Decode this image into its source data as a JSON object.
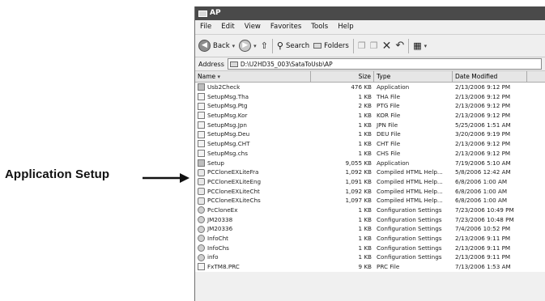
{
  "callout": {
    "label": "Application Setup"
  },
  "window": {
    "title": "AP",
    "menu": [
      "File",
      "Edit",
      "View",
      "Favorites",
      "Tools",
      "Help"
    ],
    "toolbar": {
      "back": "Back",
      "search": "Search",
      "folders": "Folders"
    },
    "address": {
      "label": "Address",
      "path": "D:\\U2HD35_003\\SataToUsb\\AP"
    },
    "columns": {
      "name": "Name",
      "size": "Size",
      "type": "Type",
      "date": "Date Modified"
    },
    "files": [
      {
        "name": "Usb2Check",
        "size": "476 KB",
        "type": "Application",
        "date": "2/13/2006 9:12 PM",
        "icon": "app"
      },
      {
        "name": "SetupMsg.Tha",
        "size": "1 KB",
        "type": "THA File",
        "date": "2/13/2006 9:12 PM",
        "icon": "file"
      },
      {
        "name": "SetupMsg.Ptg",
        "size": "2 KB",
        "type": "PTG File",
        "date": "2/13/2006 9:12 PM",
        "icon": "file"
      },
      {
        "name": "SetupMsg.Kor",
        "size": "1 KB",
        "type": "KOR File",
        "date": "2/13/2006 9:12 PM",
        "icon": "file"
      },
      {
        "name": "SetupMsg.Jpn",
        "size": "1 KB",
        "type": "JPN File",
        "date": "5/25/2006 1:51 AM",
        "icon": "file"
      },
      {
        "name": "SetupMsg.Deu",
        "size": "1 KB",
        "type": "DEU File",
        "date": "3/20/2006 9:19 PM",
        "icon": "file"
      },
      {
        "name": "SetupMsg.CHT",
        "size": "1 KB",
        "type": "CHT File",
        "date": "2/13/2006 9:12 PM",
        "icon": "file"
      },
      {
        "name": "SetupMsg.chs",
        "size": "1 KB",
        "type": "CHS File",
        "date": "2/13/2006 9:12 PM",
        "icon": "file"
      },
      {
        "name": "Setup",
        "size": "9,055 KB",
        "type": "Application",
        "date": "7/19/2006 5:10 AM",
        "icon": "app"
      },
      {
        "name": "PCCloneEXLiteFra",
        "size": "1,092 KB",
        "type": "Compiled HTML Help...",
        "date": "5/8/2006 12:42 AM",
        "icon": "help"
      },
      {
        "name": "PCCloneEXLiteEng",
        "size": "1,091 KB",
        "type": "Compiled HTML Help...",
        "date": "6/8/2006 1:00 AM",
        "icon": "help"
      },
      {
        "name": "PCCloneEXLiteCht",
        "size": "1,092 KB",
        "type": "Compiled HTML Help...",
        "date": "6/8/2006 1:00 AM",
        "icon": "help"
      },
      {
        "name": "PCCloneEXLiteChs",
        "size": "1,097 KB",
        "type": "Compiled HTML Help...",
        "date": "6/8/2006 1:00 AM",
        "icon": "help"
      },
      {
        "name": "PcCloneEx",
        "size": "1 KB",
        "type": "Configuration Settings",
        "date": "7/23/2006 10:49 PM",
        "icon": "cfg"
      },
      {
        "name": "JM20338",
        "size": "1 KB",
        "type": "Configuration Settings",
        "date": "7/23/2006 10:48 PM",
        "icon": "cfg"
      },
      {
        "name": "JM20336",
        "size": "1 KB",
        "type": "Configuration Settings",
        "date": "7/4/2006 10:52 PM",
        "icon": "cfg"
      },
      {
        "name": "InfoCht",
        "size": "1 KB",
        "type": "Configuration Settings",
        "date": "2/13/2006 9:11 PM",
        "icon": "cfg"
      },
      {
        "name": "InfoChs",
        "size": "1 KB",
        "type": "Configuration Settings",
        "date": "2/13/2006 9:11 PM",
        "icon": "cfg"
      },
      {
        "name": "info",
        "size": "1 KB",
        "type": "Configuration Settings",
        "date": "2/13/2006 9:11 PM",
        "icon": "cfg"
      },
      {
        "name": "FxTM8.PRC",
        "size": "9 KB",
        "type": "PRC File",
        "date": "7/13/2006 1:53 AM",
        "icon": "file"
      }
    ]
  }
}
